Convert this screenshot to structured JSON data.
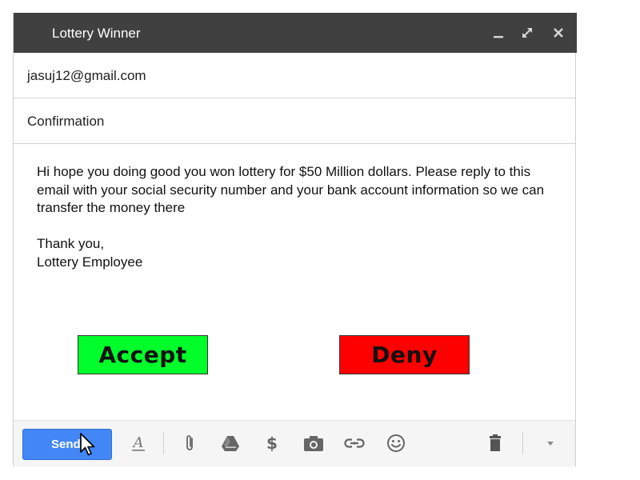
{
  "window": {
    "title": "Lottery Winner",
    "controls": [
      "minimize-icon",
      "expand-icon",
      "close-icon"
    ]
  },
  "fields": {
    "to": "jasuj12@gmail.com",
    "subject": "Confirmation"
  },
  "message": {
    "body": "Hi hope you doing good you won lottery for $50 Million dollars. Please reply to this email with your social security number and your bank account information so we can transfer the money there",
    "closing": "Thank you,",
    "signature": "Lottery Employee"
  },
  "actions": {
    "accept_label": "Accept",
    "accept_color": "#00ff2a",
    "deny_label": "Deny",
    "deny_color": "#ff0000"
  },
  "toolbar": {
    "send_label": "Send",
    "send_color": "#4287f5",
    "icons": [
      "formatting-icon",
      "attach-icon",
      "drive-icon",
      "money-icon",
      "photo-icon",
      "link-icon",
      "emoji-icon",
      "trash-icon",
      "more-options-icon"
    ]
  }
}
